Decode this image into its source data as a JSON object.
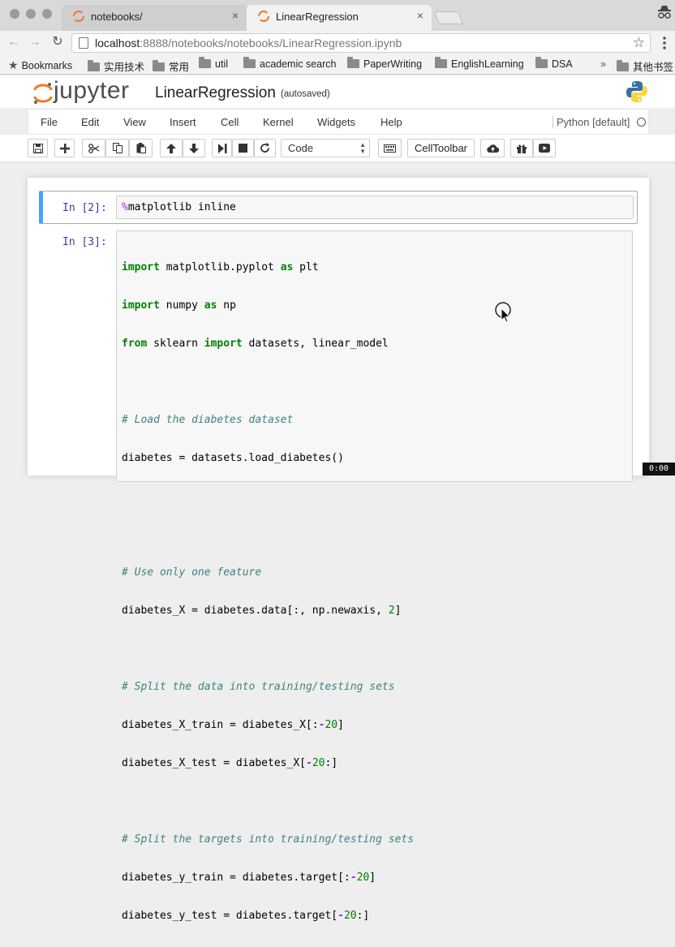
{
  "browser": {
    "tabs": [
      {
        "title": "notebooks/",
        "close": "×"
      },
      {
        "title": "LinearRegression",
        "close": "×"
      }
    ],
    "url_host": "localhost",
    "url_path": ":8888/notebooks/notebooks/LinearRegression.ipynb",
    "bookmarks": [
      "Bookmarks",
      "实用技术",
      "常用",
      "util",
      "academic search",
      "PaperWriting",
      "EnglishLearning",
      "DSA",
      "»",
      "其他书签"
    ]
  },
  "jupyter": {
    "logo_text": "jupyter",
    "notebook_title": "LinearRegression",
    "save_status": "(autosaved)",
    "menu": [
      "File",
      "Edit",
      "View",
      "Insert",
      "Cell",
      "Kernel",
      "Widgets",
      "Help"
    ],
    "kernel": "Python [default]",
    "cell_type": "Code",
    "celltoolbar_label": "CellToolbar"
  },
  "cells": [
    {
      "prompt": "In [2]:"
    },
    {
      "prompt": "In [3]:"
    }
  ],
  "code": {
    "c1_magic": "%",
    "c1_rest": "matplotlib inline",
    "l1": [
      "import",
      " matplotlib.pyplot ",
      "as",
      " plt"
    ],
    "l2": [
      "import",
      " numpy ",
      "as",
      " np"
    ],
    "l3": [
      "from",
      " sklearn ",
      "import",
      " datasets, linear_model"
    ],
    "l5": "# Load the diabetes dataset",
    "l6": "diabetes = datasets.load_diabetes()",
    "l9": "# Use only one feature",
    "l10a": "diabetes_X = diabetes.data[:, np.newaxis, ",
    "l10n": "2",
    "l10b": "]",
    "l12": "# Split the data into training/testing sets",
    "l13a": "diabetes_X_train = diabetes_X[:",
    "l13o": "-",
    "l13n": "20",
    "l13b": "]",
    "l14a": "diabetes_X_test = diabetes_X[",
    "l14o": "-",
    "l14n": "20",
    "l14b": ":]",
    "l16": "# Split the targets into training/testing sets",
    "l17a": "diabetes_y_train = diabetes.target[:",
    "l17o": "-",
    "l17n": "20",
    "l17b": "]",
    "l18a": "diabetes_y_test = diabetes.target[",
    "l18o": "-",
    "l18n": "20",
    "l18b": ":]"
  },
  "timer": "0:00",
  "colors": {
    "accent": "#42a5f5",
    "keyword": "#008000",
    "comment": "#408080",
    "prompt": "#303f9f",
    "orange": "#f37726"
  }
}
